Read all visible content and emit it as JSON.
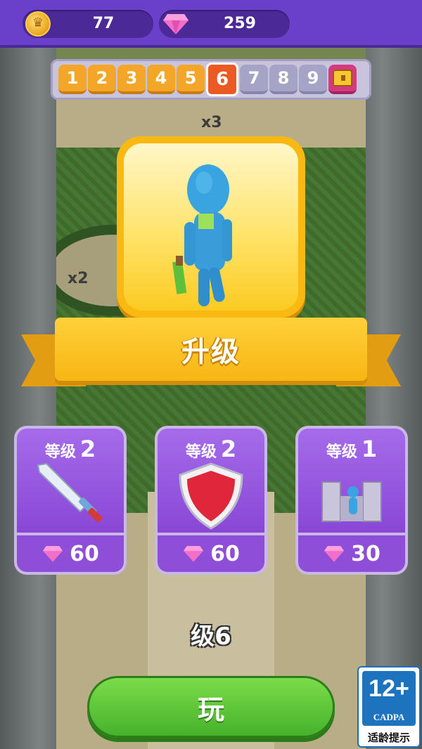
{
  "topbar": {
    "coins": "77",
    "gems": "259"
  },
  "levels": {
    "items": [
      "1",
      "2",
      "3",
      "4",
      "5",
      "6",
      "7",
      "8",
      "9"
    ],
    "current": "6"
  },
  "scene": {
    "multiplier_top": "x3",
    "multiplier_left": "x2"
  },
  "banner": {
    "title": "升级"
  },
  "upgrades": [
    {
      "level_label": "等级",
      "level": "2",
      "cost": "60",
      "icon": "sword-icon"
    },
    {
      "level_label": "等级",
      "level": "2",
      "cost": "60",
      "icon": "shield-icon"
    },
    {
      "level_label": "等级",
      "level": "1",
      "cost": "30",
      "icon": "castle-icon"
    }
  ],
  "level_text": "级6",
  "play": {
    "label": "玩"
  },
  "age_rating": {
    "age": "12+",
    "org": "CADPA",
    "note": "适龄提示"
  },
  "colors": {
    "topbar": "#6a3fc9",
    "current_level": "#ea5a22",
    "done_level": "#f3a628",
    "locked_level": "#a5a4c6",
    "card": "#8a47d6",
    "banner": "#f7b614",
    "play": "#46b22b"
  }
}
